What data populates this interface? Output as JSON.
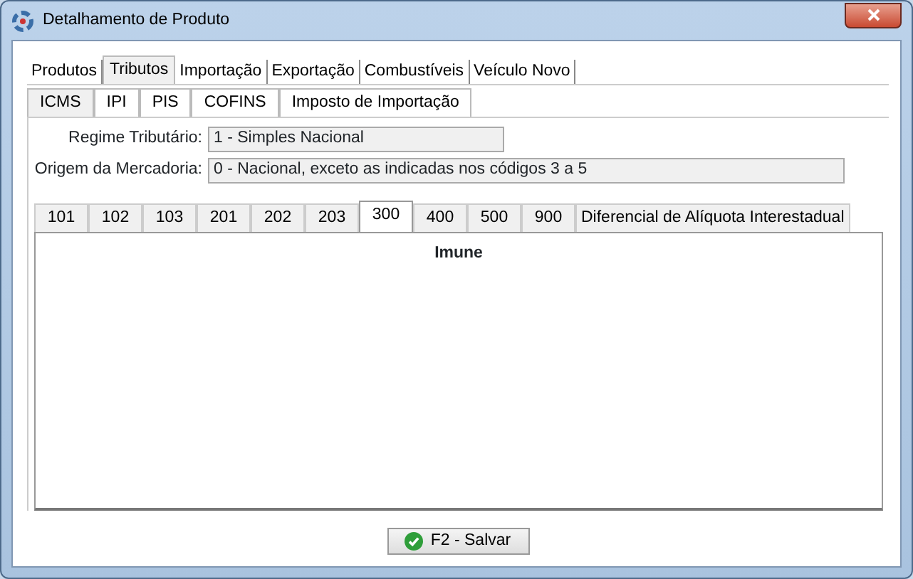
{
  "window": {
    "title": "Detalhamento de Produto"
  },
  "tabs": [
    {
      "label": "Produtos",
      "selected": false
    },
    {
      "label": "Tributos",
      "selected": true
    },
    {
      "label": "Importação",
      "selected": false
    },
    {
      "label": "Exportação",
      "selected": false
    },
    {
      "label": "Combustíveis",
      "selected": false
    },
    {
      "label": "Veículo Novo",
      "selected": false
    }
  ],
  "tax_tabs": [
    {
      "label": "ICMS",
      "selected": true
    },
    {
      "label": "IPI",
      "selected": false
    },
    {
      "label": "PIS",
      "selected": false
    },
    {
      "label": "COFINS",
      "selected": false
    },
    {
      "label": "Imposto de Importação",
      "selected": false
    }
  ],
  "fields": [
    {
      "label": "Regime Tributário:",
      "value": "1 - Simples Nacional"
    },
    {
      "label": "Origem da Mercadoria:",
      "value": "0 - Nacional, exceto as indicadas nos códigos 3 a 5"
    }
  ],
  "cst_tabs": [
    {
      "label": "101",
      "selected": false
    },
    {
      "label": "102",
      "selected": false
    },
    {
      "label": "103",
      "selected": false
    },
    {
      "label": "201",
      "selected": false
    },
    {
      "label": "202",
      "selected": false
    },
    {
      "label": "203",
      "selected": false
    },
    {
      "label": "300",
      "selected": true
    },
    {
      "label": "400",
      "selected": false
    },
    {
      "label": "500",
      "selected": false
    },
    {
      "label": "900",
      "selected": false
    },
    {
      "label": "Diferencial de Alíquota Interestadual",
      "selected": false
    }
  ],
  "panel_title": "Imune",
  "buttons": [
    {
      "label": "F2 - Salvar"
    }
  ]
}
